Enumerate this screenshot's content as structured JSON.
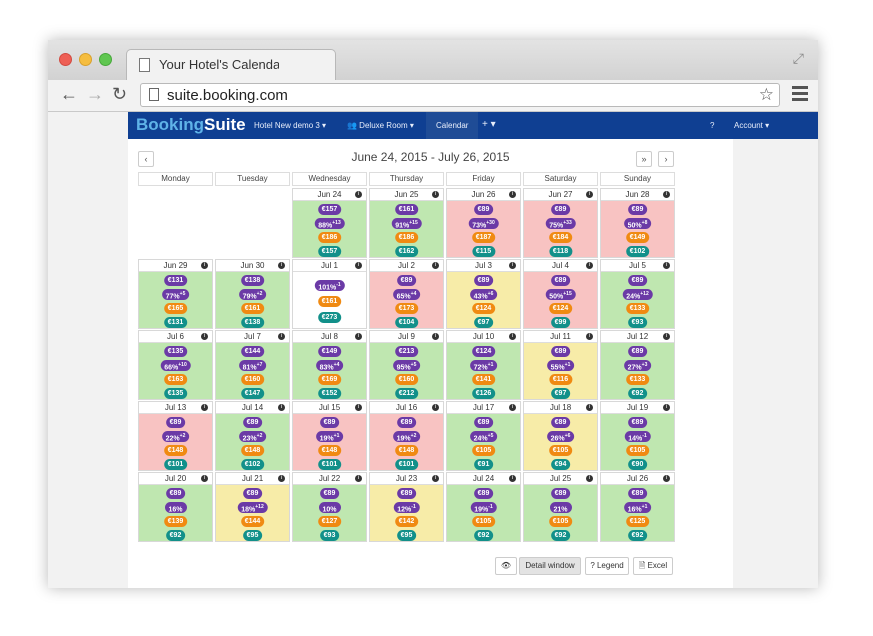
{
  "browser": {
    "tab_title": "Your Hotel's Calendar",
    "url": "suite.booking.com",
    "resize_icon": "⤢",
    "back": "←",
    "forward": "→",
    "reload": "↻",
    "star": "☆"
  },
  "app": {
    "logo_a": "Booking",
    "logo_b": "Suite",
    "hotel": "Hotel New demo 3 ▾",
    "room": "👥 Deluxe Room ▾",
    "calendar": "Calendar",
    "plus": "+ ▾",
    "help": "?",
    "account": "Account ▾"
  },
  "calendar": {
    "date_range": "June 24, 2015 - July 26, 2015",
    "prev": "‹",
    "fast": "»",
    "next": "›",
    "weekdays": [
      "Monday",
      "Tuesday",
      "Wednesday",
      "Thursday",
      "Friday",
      "Saturday",
      "Sunday"
    ],
    "days": [
      {
        "date": "Jun 24",
        "color": "green",
        "p1": "€157",
        "p2": "88%",
        "sup": "+13",
        "p3": "€186",
        "p4": "€157"
      },
      {
        "date": "Jun 25",
        "color": "green",
        "p1": "€161",
        "p2": "91%",
        "sup": "+15",
        "p3": "€186",
        "p4": "€162"
      },
      {
        "date": "Jun 26",
        "color": "red",
        "p1": "€89",
        "p2": "73%",
        "sup": "+30",
        "p3": "€187",
        "p4": "€115"
      },
      {
        "date": "Jun 27",
        "color": "red",
        "p1": "€89",
        "p2": "75%",
        "sup": "+33",
        "p3": "€184",
        "p4": "€118"
      },
      {
        "date": "Jun 28",
        "color": "red",
        "p1": "€89",
        "p2": "50%",
        "sup": "+8",
        "p3": "€149",
        "p4": "€102"
      },
      {
        "date": "Jun 29",
        "color": "green",
        "p1": "€131",
        "p2": "77%",
        "sup": "+5",
        "p3": "€165",
        "p4": "€131"
      },
      {
        "date": "Jun 30",
        "color": "green",
        "p1": "€138",
        "p2": "79%",
        "sup": "+2",
        "p3": "€161",
        "p4": "€138"
      },
      {
        "date": "Jul 1",
        "color": "white",
        "p1": "",
        "p2": "101%",
        "sup": "-1",
        "p3": "€161",
        "p4": "€273"
      },
      {
        "date": "Jul 2",
        "color": "red",
        "p1": "€89",
        "p2": "65%",
        "sup": "+4",
        "p3": "€173",
        "p4": "€104"
      },
      {
        "date": "Jul 3",
        "color": "yellow",
        "p1": "€89",
        "p2": "43%",
        "sup": "+6",
        "p3": "€124",
        "p4": "€97"
      },
      {
        "date": "Jul 4",
        "color": "red",
        "p1": "€89",
        "p2": "50%",
        "sup": "+15",
        "p3": "€124",
        "p4": "€99"
      },
      {
        "date": "Jul 5",
        "color": "green",
        "p1": "€89",
        "p2": "24%",
        "sup": "+12",
        "p3": "€133",
        "p4": "€93"
      },
      {
        "date": "Jul 6",
        "color": "green",
        "p1": "€135",
        "p2": "66%",
        "sup": "+10",
        "p3": "€163",
        "p4": "€135"
      },
      {
        "date": "Jul 7",
        "color": "green",
        "p1": "€144",
        "p2": "81%",
        "sup": "+7",
        "p3": "€160",
        "p4": "€147"
      },
      {
        "date": "Jul 8",
        "color": "green",
        "p1": "€149",
        "p2": "83%",
        "sup": "+4",
        "p3": "€169",
        "p4": "€152"
      },
      {
        "date": "Jul 9",
        "color": "green",
        "p1": "€213",
        "p2": "95%",
        "sup": "+5",
        "p3": "€160",
        "p4": "€212"
      },
      {
        "date": "Jul 10",
        "color": "green",
        "p1": "€124",
        "p2": "72%",
        "sup": "+1",
        "p3": "€141",
        "p4": "€126"
      },
      {
        "date": "Jul 11",
        "color": "yellow",
        "p1": "€89",
        "p2": "55%",
        "sup": "+1",
        "p3": "€116",
        "p4": "€97"
      },
      {
        "date": "Jul 12",
        "color": "green",
        "p1": "€89",
        "p2": "27%",
        "sup": "+3",
        "p3": "€133",
        "p4": "€92"
      },
      {
        "date": "Jul 13",
        "color": "red",
        "p1": "€89",
        "p2": "22%",
        "sup": "+2",
        "p3": "€148",
        "p4": "€101"
      },
      {
        "date": "Jul 14",
        "color": "green",
        "p1": "€89",
        "p2": "23%",
        "sup": "+2",
        "p3": "€148",
        "p4": "€102"
      },
      {
        "date": "Jul 15",
        "color": "red",
        "p1": "€89",
        "p2": "19%",
        "sup": "+1",
        "p3": "€148",
        "p4": "€101"
      },
      {
        "date": "Jul 16",
        "color": "red",
        "p1": "€89",
        "p2": "19%",
        "sup": "+2",
        "p3": "€148",
        "p4": "€101"
      },
      {
        "date": "Jul 17",
        "color": "green",
        "p1": "€89",
        "p2": "24%",
        "sup": "+5",
        "p3": "€105",
        "p4": "€91"
      },
      {
        "date": "Jul 18",
        "color": "yellow",
        "p1": "€89",
        "p2": "26%",
        "sup": "+6",
        "p3": "€105",
        "p4": "€94"
      },
      {
        "date": "Jul 19",
        "color": "green",
        "p1": "€89",
        "p2": "14%",
        "sup": "-1",
        "p3": "€105",
        "p4": "€90"
      },
      {
        "date": "Jul 20",
        "color": "green",
        "p1": "€89",
        "p2": "16%",
        "sup": "",
        "p3": "€139",
        "p4": "€92"
      },
      {
        "date": "Jul 21",
        "color": "yellow",
        "p1": "€89",
        "p2": "18%",
        "sup": "+12",
        "p3": "€144",
        "p4": "€95"
      },
      {
        "date": "Jul 22",
        "color": "green",
        "p1": "€89",
        "p2": "10%",
        "sup": "",
        "p3": "€127",
        "p4": "€93"
      },
      {
        "date": "Jul 23",
        "color": "yellow",
        "p1": "€89",
        "p2": "12%",
        "sup": "-1",
        "p3": "€142",
        "p4": "€95"
      },
      {
        "date": "Jul 24",
        "color": "green",
        "p1": "€89",
        "p2": "19%",
        "sup": "-1",
        "p3": "€105",
        "p4": "€92"
      },
      {
        "date": "Jul 25",
        "color": "green",
        "p1": "€89",
        "p2": "21%",
        "sup": "",
        "p3": "€105",
        "p4": "€92"
      },
      {
        "date": "Jul 26",
        "color": "green",
        "p1": "€89",
        "p2": "16%",
        "sup": "+1",
        "p3": "€125",
        "p4": "€92"
      }
    ]
  },
  "footer": {
    "eye": "👁",
    "detail": "Detail window",
    "legend": "? Legend",
    "excel": "🗎 Excel"
  }
}
